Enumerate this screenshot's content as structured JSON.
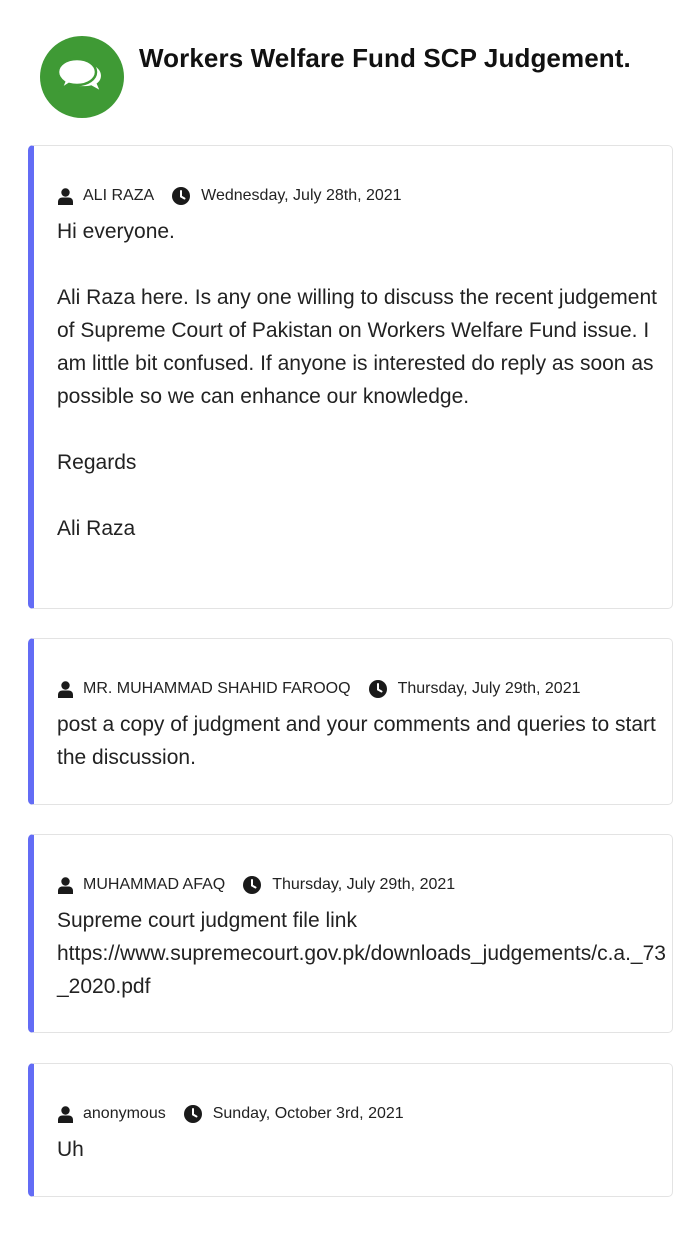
{
  "header": {
    "title": "Workers Welfare Fund SCP Judgement.",
    "icon": "chat-bubbles-icon",
    "badge_color": "#3f9a35"
  },
  "accent_color": "#636cf5",
  "posts": [
    {
      "author": "ALI RAZA",
      "date": "Wednesday, July 28th, 2021",
      "paragraphs": [
        "Hi everyone.",
        "Ali Raza here. Is any one willing to discuss the recent judgement of Supreme Court of Pakistan on Workers Welfare Fund issue. I am little bit confused. If anyone is interested do reply as soon as possible so we can enhance our knowledge.",
        "Regards",
        "Ali Raza"
      ]
    },
    {
      "author": "MR. MUHAMMAD SHAHID FAROOQ",
      "date": "Thursday, July 29th, 2021",
      "paragraphs": [
        "post a copy of judgment and your comments and queries to start the discussion."
      ]
    },
    {
      "author": "MUHAMMAD AFAQ",
      "date": "Thursday, July 29th, 2021",
      "paragraphs": [
        "Supreme court judgment file link",
        "https://www.supremecourt.gov.pk/downloads_judgements/c.a._73_2020.pdf"
      ]
    },
    {
      "author": "anonymous",
      "date": "Sunday, October 3rd, 2021",
      "paragraphs": [
        "Uh"
      ]
    }
  ]
}
